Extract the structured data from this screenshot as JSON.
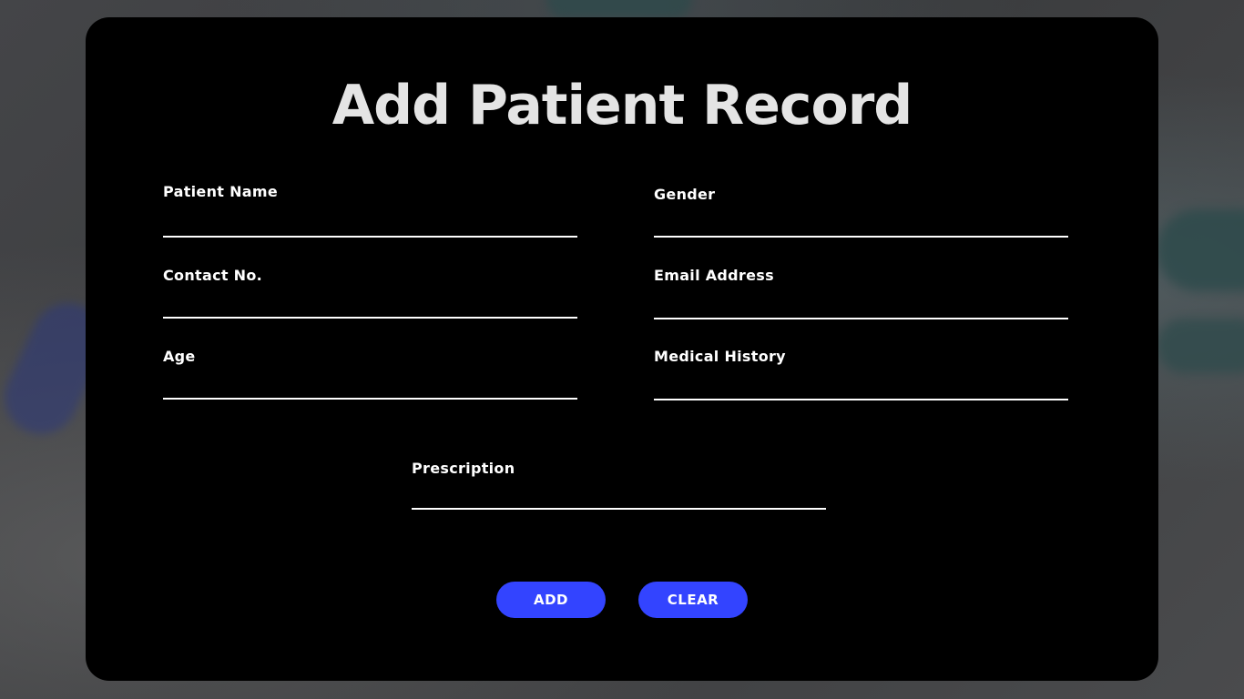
{
  "form": {
    "title": "Add Patient Record",
    "fields": {
      "patient_name": {
        "label": "Patient Name",
        "value": ""
      },
      "gender": {
        "label": "Gender",
        "value": ""
      },
      "contact_no": {
        "label": "Contact No.",
        "value": ""
      },
      "email_address": {
        "label": "Email Address",
        "value": ""
      },
      "age": {
        "label": "Age",
        "value": ""
      },
      "medical_history": {
        "label": "Medical History",
        "value": ""
      },
      "prescription": {
        "label": "Prescription",
        "value": ""
      }
    },
    "buttons": {
      "add_label": "ADD",
      "clear_label": "CLEAR"
    }
  },
  "colors": {
    "card_background": "#000000",
    "button_accent": "#3344ff",
    "title_text": "#e4e4e4",
    "field_text": "#ffffff"
  }
}
